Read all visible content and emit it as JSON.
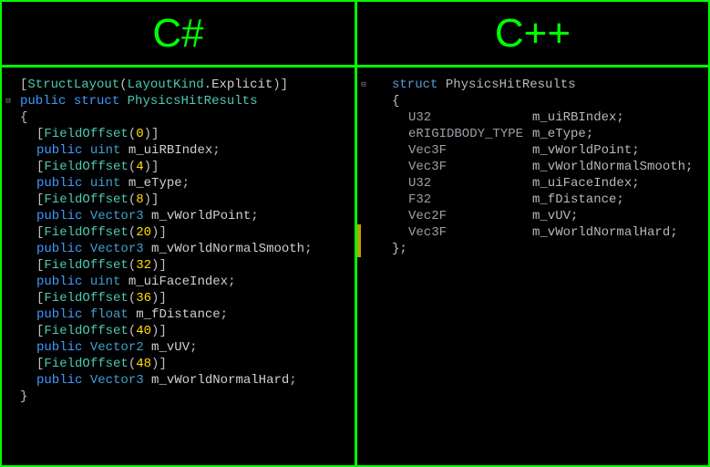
{
  "left": {
    "title": "C#",
    "attribute": {
      "name": "StructLayout",
      "arg1": "LayoutKind",
      "arg2": "Explicit"
    },
    "struct_decl": {
      "mod": "public",
      "kw": "struct",
      "name": "PhysicsHitResults"
    },
    "fields": [
      {
        "offset": "0",
        "mod": "public",
        "type": "uint",
        "name": "m_uiRBIndex"
      },
      {
        "offset": "4",
        "mod": "public",
        "type": "uint",
        "name": "m_eType"
      },
      {
        "offset": "8",
        "mod": "public",
        "type": "Vector3",
        "name": "m_vWorldPoint"
      },
      {
        "offset": "20",
        "mod": "public",
        "type": "Vector3",
        "name": "m_vWorldNormalSmooth"
      },
      {
        "offset": "32",
        "mod": "public",
        "type": "uint",
        "name": "m_uiFaceIndex"
      },
      {
        "offset": "36",
        "mod": "public",
        "type": "float",
        "name": "m_fDistance"
      },
      {
        "offset": "40",
        "mod": "public",
        "type": "Vector2",
        "name": "m_vUV"
      },
      {
        "offset": "48",
        "mod": "public",
        "type": "Vector3",
        "name": "m_vWorldNormalHard"
      }
    ]
  },
  "right": {
    "title": "C++",
    "struct_decl": {
      "kw": "struct",
      "name": "PhysicsHitResults"
    },
    "fields": [
      {
        "type": "U32",
        "name": "m_uiRBIndex"
      },
      {
        "type": "eRIGIDBODY_TYPE",
        "name": "m_eType"
      },
      {
        "type": "Vec3F",
        "name": "m_vWorldPoint"
      },
      {
        "type": "Vec3F",
        "name": "m_vWorldNormalSmooth"
      },
      {
        "type": "U32",
        "name": "m_uiFaceIndex"
      },
      {
        "type": "F32",
        "name": "m_fDistance"
      },
      {
        "type": "Vec2F",
        "name": "m_vUV"
      },
      {
        "type": "Vec3F",
        "name": "m_vWorldNormalHard"
      }
    ]
  }
}
